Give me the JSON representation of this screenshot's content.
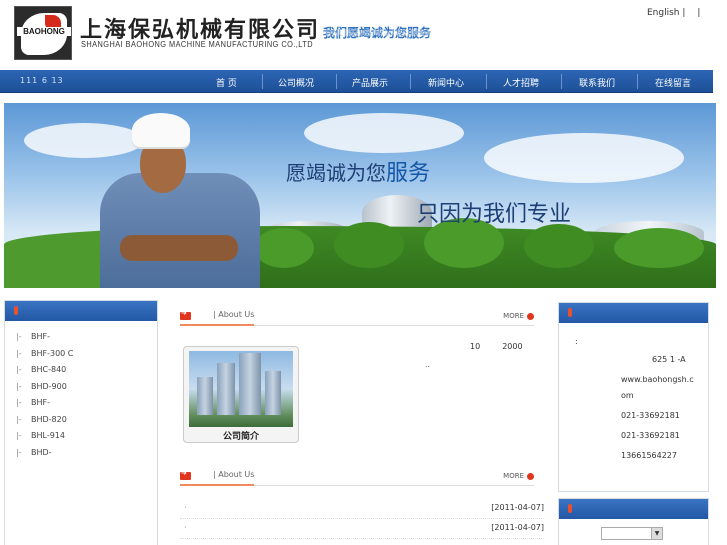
{
  "header": {
    "logo_text": "BAOHONG",
    "company_cn": "上海保弘机械有限公司",
    "company_en": "SHANGHAI BAOHONG MACHINE MANUFACTURING CO.,LTD",
    "slogan": "我们愿竭诚为您服务",
    "top_links": [
      "English |",
      "|"
    ]
  },
  "nav": {
    "phone": "111 6 13",
    "items": [
      "首 页",
      "公司概况",
      "产品展示",
      "新闻中心",
      "人才招聘",
      "联系我们",
      "在线留言"
    ]
  },
  "banner": {
    "line1_prefix": "愿竭诚为您",
    "line1_emph": "服务",
    "line2": "只因为我们专业"
  },
  "products": [
    "BHF-",
    "BHF-300    C",
    "BHC-840",
    "BHD-900",
    "BHF-",
    "BHD-820",
    "BHL-914",
    "BHD-"
  ],
  "about": {
    "title": "| About Us",
    "more": "MORE",
    "photo_caption": "公司简介",
    "num1": "10",
    "num2": "2000",
    "dots": ".."
  },
  "news": {
    "title": "| About Us",
    "more": "MORE",
    "rows": [
      {
        "bullet": "·",
        "date": "[2011-04-07]"
      },
      {
        "bullet": "·",
        "date": "[2011-04-07]"
      }
    ]
  },
  "contact": {
    "colon": ":",
    "address": "625 1 -A",
    "website1": "www.baohongsh.c",
    "website2": "om",
    "phone": "021-33692181",
    "fax": "021-33692181",
    "mobile": "13661564227"
  },
  "colors": {
    "nav_blue": "#2358a6",
    "accent_red": "#e0351e",
    "slogan_blue": "#2a6fc0"
  }
}
